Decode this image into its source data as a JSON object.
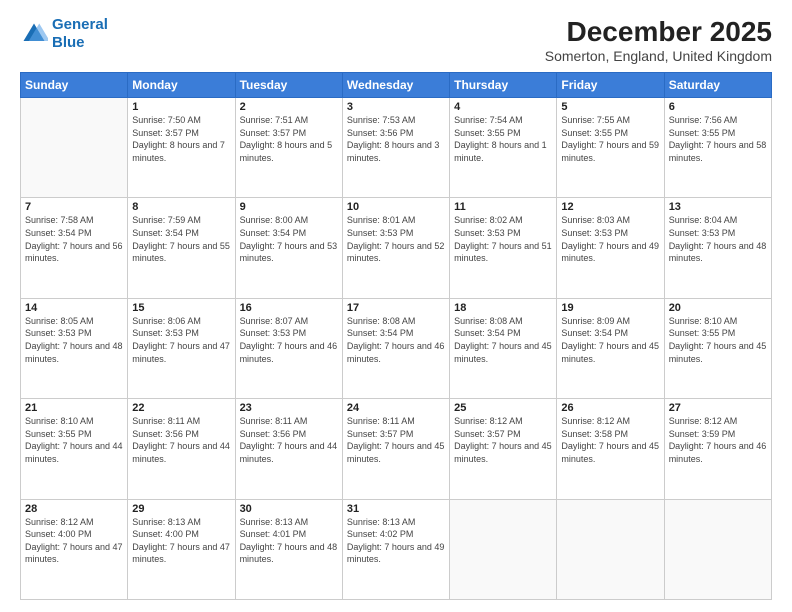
{
  "logo": {
    "line1": "General",
    "line2": "Blue"
  },
  "title": "December 2025",
  "subtitle": "Somerton, England, United Kingdom",
  "days_header": [
    "Sunday",
    "Monday",
    "Tuesday",
    "Wednesday",
    "Thursday",
    "Friday",
    "Saturday"
  ],
  "weeks": [
    [
      {
        "num": "",
        "sunrise": "",
        "sunset": "",
        "daylight": ""
      },
      {
        "num": "1",
        "sunrise": "Sunrise: 7:50 AM",
        "sunset": "Sunset: 3:57 PM",
        "daylight": "Daylight: 8 hours and 7 minutes."
      },
      {
        "num": "2",
        "sunrise": "Sunrise: 7:51 AM",
        "sunset": "Sunset: 3:57 PM",
        "daylight": "Daylight: 8 hours and 5 minutes."
      },
      {
        "num": "3",
        "sunrise": "Sunrise: 7:53 AM",
        "sunset": "Sunset: 3:56 PM",
        "daylight": "Daylight: 8 hours and 3 minutes."
      },
      {
        "num": "4",
        "sunrise": "Sunrise: 7:54 AM",
        "sunset": "Sunset: 3:55 PM",
        "daylight": "Daylight: 8 hours and 1 minute."
      },
      {
        "num": "5",
        "sunrise": "Sunrise: 7:55 AM",
        "sunset": "Sunset: 3:55 PM",
        "daylight": "Daylight: 7 hours and 59 minutes."
      },
      {
        "num": "6",
        "sunrise": "Sunrise: 7:56 AM",
        "sunset": "Sunset: 3:55 PM",
        "daylight": "Daylight: 7 hours and 58 minutes."
      }
    ],
    [
      {
        "num": "7",
        "sunrise": "Sunrise: 7:58 AM",
        "sunset": "Sunset: 3:54 PM",
        "daylight": "Daylight: 7 hours and 56 minutes."
      },
      {
        "num": "8",
        "sunrise": "Sunrise: 7:59 AM",
        "sunset": "Sunset: 3:54 PM",
        "daylight": "Daylight: 7 hours and 55 minutes."
      },
      {
        "num": "9",
        "sunrise": "Sunrise: 8:00 AM",
        "sunset": "Sunset: 3:54 PM",
        "daylight": "Daylight: 7 hours and 53 minutes."
      },
      {
        "num": "10",
        "sunrise": "Sunrise: 8:01 AM",
        "sunset": "Sunset: 3:53 PM",
        "daylight": "Daylight: 7 hours and 52 minutes."
      },
      {
        "num": "11",
        "sunrise": "Sunrise: 8:02 AM",
        "sunset": "Sunset: 3:53 PM",
        "daylight": "Daylight: 7 hours and 51 minutes."
      },
      {
        "num": "12",
        "sunrise": "Sunrise: 8:03 AM",
        "sunset": "Sunset: 3:53 PM",
        "daylight": "Daylight: 7 hours and 49 minutes."
      },
      {
        "num": "13",
        "sunrise": "Sunrise: 8:04 AM",
        "sunset": "Sunset: 3:53 PM",
        "daylight": "Daylight: 7 hours and 48 minutes."
      }
    ],
    [
      {
        "num": "14",
        "sunrise": "Sunrise: 8:05 AM",
        "sunset": "Sunset: 3:53 PM",
        "daylight": "Daylight: 7 hours and 48 minutes."
      },
      {
        "num": "15",
        "sunrise": "Sunrise: 8:06 AM",
        "sunset": "Sunset: 3:53 PM",
        "daylight": "Daylight: 7 hours and 47 minutes."
      },
      {
        "num": "16",
        "sunrise": "Sunrise: 8:07 AM",
        "sunset": "Sunset: 3:53 PM",
        "daylight": "Daylight: 7 hours and 46 minutes."
      },
      {
        "num": "17",
        "sunrise": "Sunrise: 8:08 AM",
        "sunset": "Sunset: 3:54 PM",
        "daylight": "Daylight: 7 hours and 46 minutes."
      },
      {
        "num": "18",
        "sunrise": "Sunrise: 8:08 AM",
        "sunset": "Sunset: 3:54 PM",
        "daylight": "Daylight: 7 hours and 45 minutes."
      },
      {
        "num": "19",
        "sunrise": "Sunrise: 8:09 AM",
        "sunset": "Sunset: 3:54 PM",
        "daylight": "Daylight: 7 hours and 45 minutes."
      },
      {
        "num": "20",
        "sunrise": "Sunrise: 8:10 AM",
        "sunset": "Sunset: 3:55 PM",
        "daylight": "Daylight: 7 hours and 45 minutes."
      }
    ],
    [
      {
        "num": "21",
        "sunrise": "Sunrise: 8:10 AM",
        "sunset": "Sunset: 3:55 PM",
        "daylight": "Daylight: 7 hours and 44 minutes."
      },
      {
        "num": "22",
        "sunrise": "Sunrise: 8:11 AM",
        "sunset": "Sunset: 3:56 PM",
        "daylight": "Daylight: 7 hours and 44 minutes."
      },
      {
        "num": "23",
        "sunrise": "Sunrise: 8:11 AM",
        "sunset": "Sunset: 3:56 PM",
        "daylight": "Daylight: 7 hours and 44 minutes."
      },
      {
        "num": "24",
        "sunrise": "Sunrise: 8:11 AM",
        "sunset": "Sunset: 3:57 PM",
        "daylight": "Daylight: 7 hours and 45 minutes."
      },
      {
        "num": "25",
        "sunrise": "Sunrise: 8:12 AM",
        "sunset": "Sunset: 3:57 PM",
        "daylight": "Daylight: 7 hours and 45 minutes."
      },
      {
        "num": "26",
        "sunrise": "Sunrise: 8:12 AM",
        "sunset": "Sunset: 3:58 PM",
        "daylight": "Daylight: 7 hours and 45 minutes."
      },
      {
        "num": "27",
        "sunrise": "Sunrise: 8:12 AM",
        "sunset": "Sunset: 3:59 PM",
        "daylight": "Daylight: 7 hours and 46 minutes."
      }
    ],
    [
      {
        "num": "28",
        "sunrise": "Sunrise: 8:12 AM",
        "sunset": "Sunset: 4:00 PM",
        "daylight": "Daylight: 7 hours and 47 minutes."
      },
      {
        "num": "29",
        "sunrise": "Sunrise: 8:13 AM",
        "sunset": "Sunset: 4:00 PM",
        "daylight": "Daylight: 7 hours and 47 minutes."
      },
      {
        "num": "30",
        "sunrise": "Sunrise: 8:13 AM",
        "sunset": "Sunset: 4:01 PM",
        "daylight": "Daylight: 7 hours and 48 minutes."
      },
      {
        "num": "31",
        "sunrise": "Sunrise: 8:13 AM",
        "sunset": "Sunset: 4:02 PM",
        "daylight": "Daylight: 7 hours and 49 minutes."
      },
      {
        "num": "",
        "sunrise": "",
        "sunset": "",
        "daylight": ""
      },
      {
        "num": "",
        "sunrise": "",
        "sunset": "",
        "daylight": ""
      },
      {
        "num": "",
        "sunrise": "",
        "sunset": "",
        "daylight": ""
      }
    ]
  ]
}
